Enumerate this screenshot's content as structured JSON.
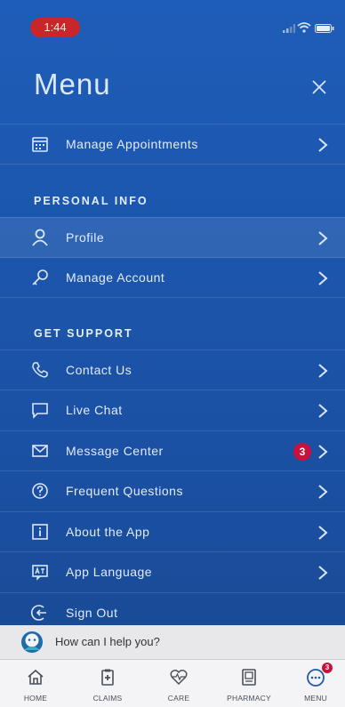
{
  "status_bar": {
    "time": "1:44"
  },
  "header": {
    "title": "Menu"
  },
  "top_items": [
    {
      "label": "Manage Appointments",
      "icon": "calendar-icon"
    }
  ],
  "sections": [
    {
      "title": "PERSONAL INFO",
      "items": [
        {
          "label": "Profile",
          "icon": "person-icon"
        },
        {
          "label": "Manage Account",
          "icon": "key-icon"
        }
      ]
    },
    {
      "title": "GET SUPPORT",
      "items": [
        {
          "label": "Contact Us",
          "icon": "phone-icon"
        },
        {
          "label": "Live Chat",
          "icon": "chat-bubble-icon"
        },
        {
          "label": "Message Center",
          "icon": "envelope-icon",
          "badge": "3"
        },
        {
          "label": "Frequent Questions",
          "icon": "question-icon"
        },
        {
          "label": "About the App",
          "icon": "info-icon"
        },
        {
          "label": "App Language",
          "icon": "language-icon"
        },
        {
          "label": "Sign Out",
          "icon": "sign-out-icon"
        }
      ]
    }
  ],
  "chat": {
    "placeholder": "How can I help you?"
  },
  "tabs": [
    {
      "label": "HOME",
      "icon": "home-icon"
    },
    {
      "label": "CLAIMS",
      "icon": "claims-icon"
    },
    {
      "label": "CARE",
      "icon": "care-icon"
    },
    {
      "label": "PHARMACY",
      "icon": "pharmacy-icon"
    },
    {
      "label": "MENU",
      "icon": "menu-dots-icon",
      "badge": "3"
    }
  ],
  "colors": {
    "background": "#1c55ab",
    "badge": "#c8123c",
    "status_pill": "#c9262a"
  }
}
